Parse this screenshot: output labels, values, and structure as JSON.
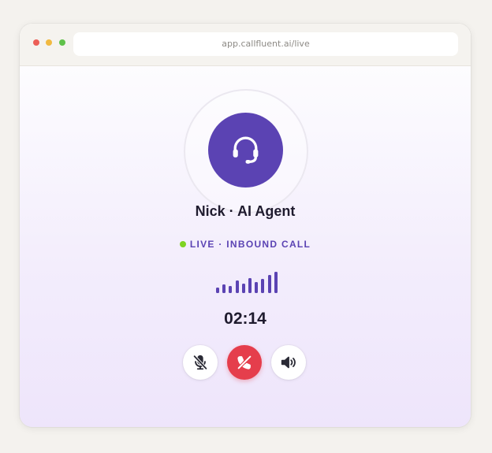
{
  "browser": {
    "url": "app.callfluent.ai/live",
    "window_controls": [
      "close",
      "minimize",
      "maximize"
    ]
  },
  "call": {
    "agent_name": "Nick · AI Agent",
    "status": "LIVE · INBOUND CALL",
    "timer": "02:14",
    "avatar_icon": "headset-icon",
    "waveform_levels": [
      0.25,
      0.42,
      0.35,
      0.58,
      0.45,
      0.72,
      0.5,
      0.68,
      0.85,
      1.0
    ]
  },
  "controls": [
    {
      "name": "mute-button",
      "icon": "mic-off-icon"
    },
    {
      "name": "end-call-button",
      "icon": "phone-hangup-icon"
    },
    {
      "name": "speaker-button",
      "icon": "speaker-icon"
    }
  ],
  "colors": {
    "accent": "#5b43b3",
    "live": "#7ed321",
    "end_call": "#e53e4c",
    "text": "#1f1b2e"
  }
}
